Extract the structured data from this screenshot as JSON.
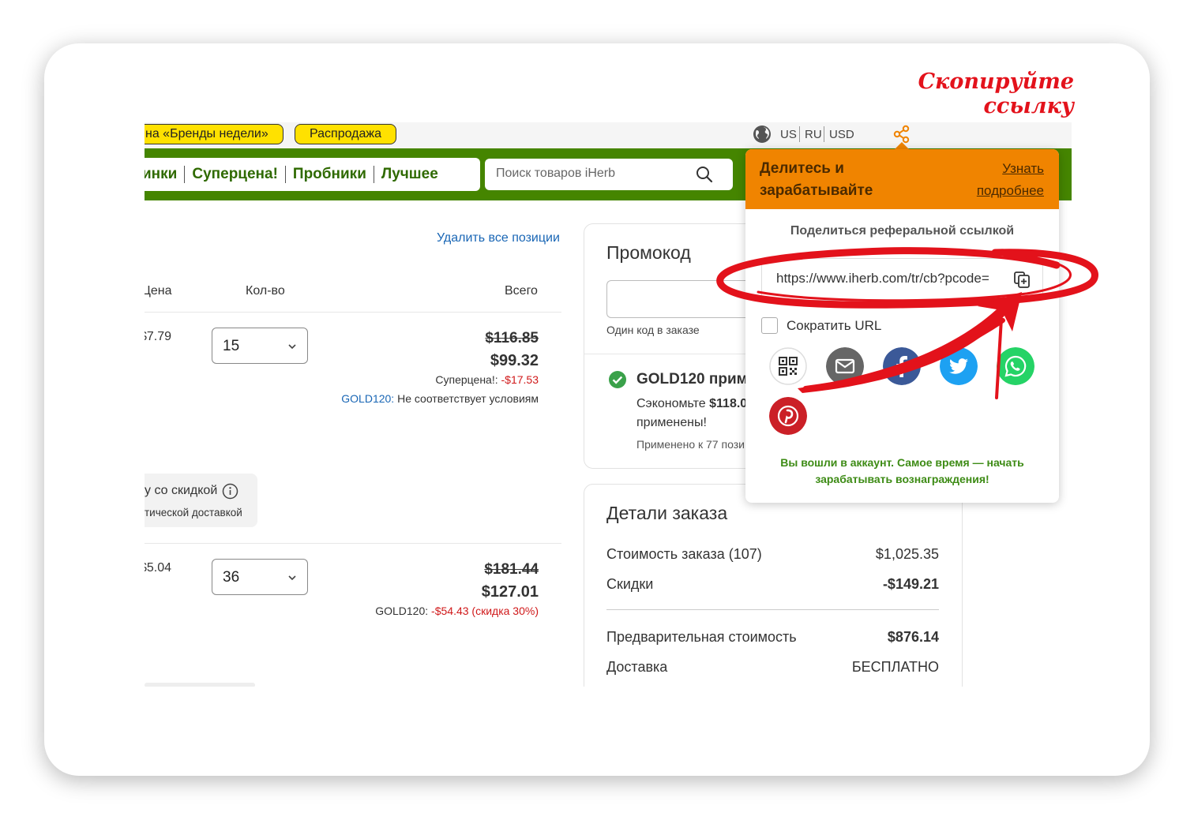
{
  "annotation": {
    "title": "Скопируйте ссылку",
    "color": "#e3121b"
  },
  "topbar": {
    "brands_pill": "на «Бренды недели»",
    "sale_pill": "Распродажа",
    "locale": [
      "US",
      "RU",
      "USD"
    ],
    "icons": [
      "globe-icon",
      "share-icon"
    ]
  },
  "nav": {
    "links": [
      "инки",
      "Суперцена!",
      "Пробники",
      "Лучшее"
    ],
    "search_placeholder": "Поиск товаров iHerb",
    "brand_color": "#458500"
  },
  "cart": {
    "clear_all": "Удалить все позиции",
    "columns": {
      "price": "Цена",
      "qty": "Кол-во",
      "total": "Всего"
    },
    "items": [
      {
        "price": "$7.79",
        "qty": "15",
        "old_total": "$116.85",
        "total": "$99.32",
        "disc1_label": "Суперцена!:",
        "disc1_value": "-$17.53",
        "disc2_code": "GOLD120:",
        "disc2_text": "Не соответствует условиям"
      },
      {
        "price": "$5.04",
        "qty": "36",
        "old_total": "$181.44",
        "total": "$127.01",
        "disc1_label": "GOLD120:",
        "disc1_value": "-$54.43 (скидка 30%)"
      }
    ],
    "promo_banner": {
      "line1": "у со скидкой",
      "line2": "тической доставкой"
    }
  },
  "promo": {
    "title": "Промокод",
    "note": "Один код в заказе",
    "applied_title": "GOLD120 приме",
    "save_prefix": "Сэкономьте",
    "save_amount": "$118.0",
    "applied_text": "применены!",
    "applied_count": "Применено к 77 пози"
  },
  "details": {
    "title": "Детали заказа",
    "rows": [
      {
        "label": "Стоимость заказа (107)",
        "value": "$1,025.35"
      },
      {
        "label": "Скидки",
        "value": "-$149.21"
      },
      {
        "label": "Предварительная стоимость",
        "value": "$876.14"
      },
      {
        "label": "Доставка",
        "value": "БЕСПЛАТНО"
      }
    ]
  },
  "share_popover": {
    "header_title": "Делитесь и зарабатывайте",
    "learn_more": "Узнать подробнее",
    "subtitle": "Поделиться реферальной ссылкой",
    "url": "https://www.iherb.com/tr/cb?pcode=",
    "shorten_label": "Сократить URL",
    "shorten_checked": false,
    "channels": [
      {
        "name": "qr-code",
        "color": "#ffffff"
      },
      {
        "name": "email",
        "color": "#666666"
      },
      {
        "name": "facebook",
        "color": "#3b5998"
      },
      {
        "name": "twitter",
        "color": "#1da1f2"
      },
      {
        "name": "whatsapp",
        "color": "#25d366"
      },
      {
        "name": "pinterest",
        "color": "#cb2027"
      }
    ],
    "footer": "Вы вошли в аккаунт. Самое время — начать зарабатывать вознаграждения!",
    "header_color": "#f08400"
  }
}
